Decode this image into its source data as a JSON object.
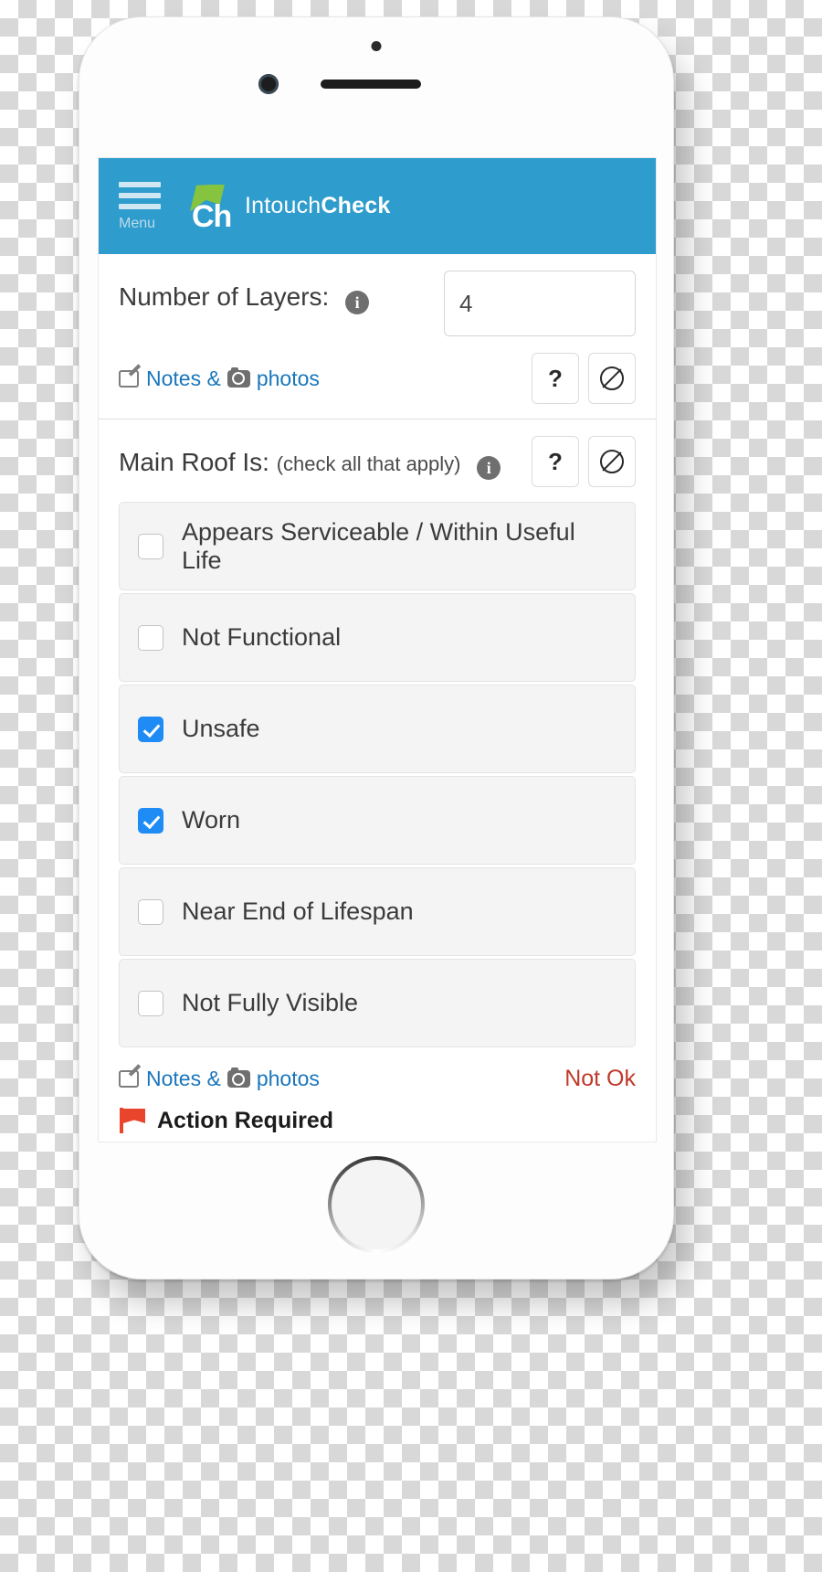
{
  "header": {
    "menu_label": "Menu",
    "menu_icon": "hamburger-menu-icon",
    "logo_text": "Ch",
    "brand_prefix": "Intouch",
    "brand_suffix": "Check",
    "background_color": "#2e9ccc",
    "logo_leaf_color": "#86c440"
  },
  "sections": {
    "layers": {
      "label": "Number of Layers:",
      "info_icon": "info-icon",
      "input_value": "4",
      "input_placeholder": "",
      "notes_label_prefix": "Notes &",
      "notes_label_suffix": "photos",
      "help_button": "?",
      "na_button": "circle-slash-icon"
    },
    "main_roof": {
      "label": "Main Roof Is:",
      "sublabel": "(check all that apply)",
      "info_icon": "info-icon",
      "help_button": "?",
      "na_button": "circle-slash-icon",
      "options": [
        {
          "label": "Appears Serviceable / Within Useful Life",
          "checked": false
        },
        {
          "label": "Not Functional",
          "checked": false
        },
        {
          "label": "Unsafe",
          "checked": true
        },
        {
          "label": "Worn",
          "checked": true
        },
        {
          "label": "Near End of Lifespan",
          "checked": false
        },
        {
          "label": "Not Fully Visible",
          "checked": false
        }
      ],
      "notes_label_prefix": "Notes &",
      "notes_label_suffix": "photos",
      "status_text": "Not Ok",
      "status_color": "#c0392b",
      "action_text": "Action Required",
      "action_icon": "red-flag-icon",
      "checkbox_checked_color": "#1f8bf4"
    }
  }
}
